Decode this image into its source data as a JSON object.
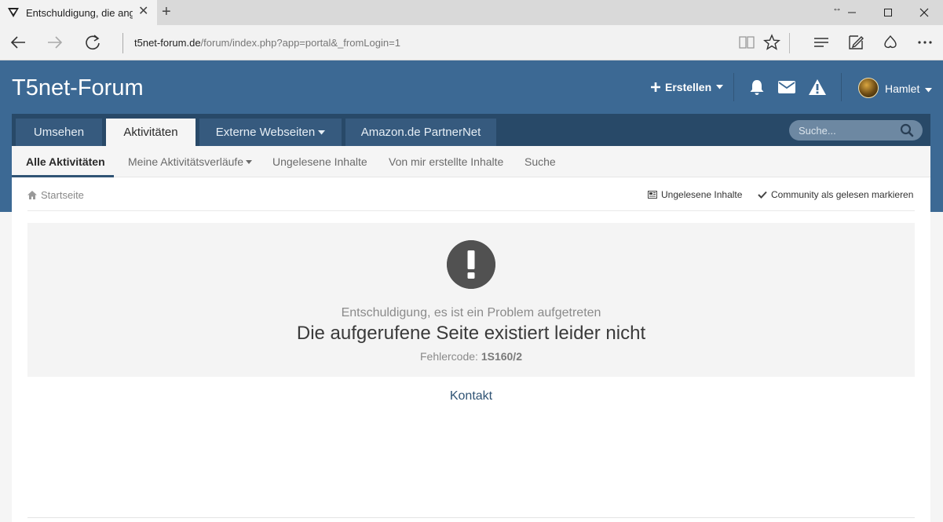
{
  "browser": {
    "tab_title": "Entschuldigung, die angeforderte Seite",
    "url_host": "t5net-forum.de",
    "url_path": "/forum/index.php?app=portal&_fromLogin=1"
  },
  "site": {
    "title": "T5net-Forum"
  },
  "header": {
    "create_label": "Erstellen",
    "user_name": "Hamlet"
  },
  "main_nav": {
    "tabs": [
      {
        "label": "Umsehen"
      },
      {
        "label": "Aktivitäten"
      },
      {
        "label": "Externe Webseiten"
      },
      {
        "label": "Amazon.de PartnerNet"
      }
    ],
    "active_index": 1
  },
  "search": {
    "placeholder": "Suche..."
  },
  "sub_nav": {
    "items": [
      {
        "label": "Alle Aktivitäten"
      },
      {
        "label": "Meine Aktivitätsverläufe"
      },
      {
        "label": "Ungelesene Inhalte"
      },
      {
        "label": "Von mir erstellte Inhalte"
      },
      {
        "label": "Suche"
      }
    ]
  },
  "breadcrumb": {
    "home": "Startseite",
    "unread": "Ungelesene Inhalte",
    "mark_read": "Community als gelesen markieren"
  },
  "error": {
    "subtitle": "Entschuldigung, es ist ein Problem aufgetreten",
    "message": "Die aufgerufene Seite existiert leider nicht",
    "code_label": "Fehlercode:",
    "code": "1S160/2"
  },
  "contact": {
    "label": "Kontakt"
  },
  "colors": {
    "header_bg": "#3c6994",
    "nav_bg": "#284968",
    "accent": "#2f5374",
    "error_icon": "#515151"
  }
}
